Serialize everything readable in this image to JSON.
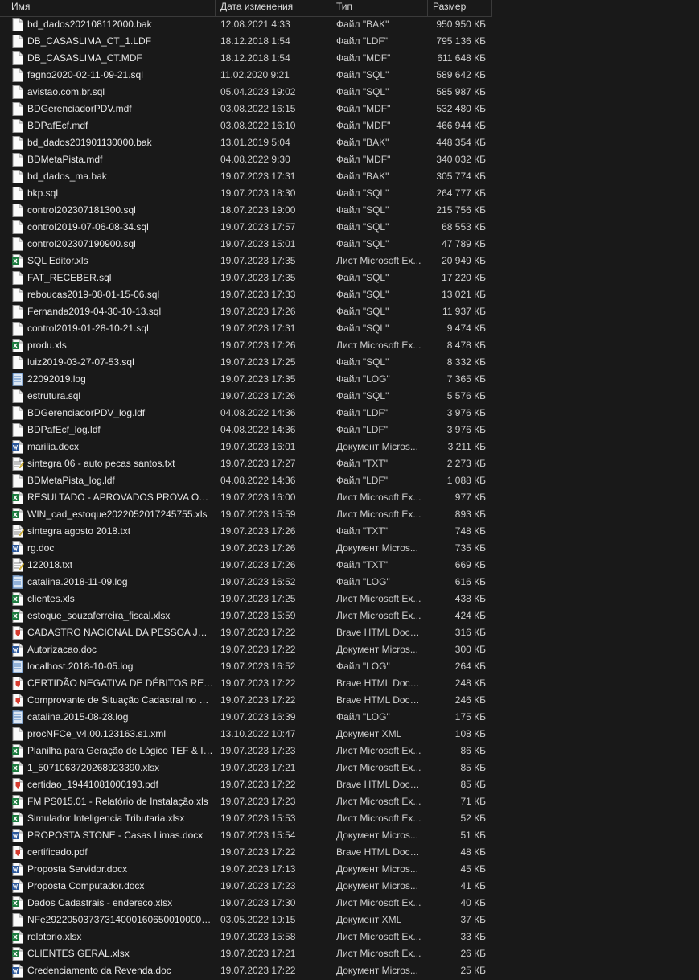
{
  "columns": {
    "name": "Имя",
    "date": "Дата изменения",
    "type": "Тип",
    "size": "Размер"
  },
  "icon_colors": {
    "file": "#ffffff",
    "excel": "#1d7a3f",
    "word": "#2b579a",
    "pdf": "#d63b2f",
    "log": "#4a7fbf",
    "txt": "#e8c84a"
  },
  "files": [
    {
      "name": "bd_dados202108112000.bak",
      "date": "12.08.2021 4:33",
      "type": "Файл \"BAK\"",
      "size": "950 950 КБ",
      "icon": "file"
    },
    {
      "name": "DB_CASASLIMA_CT_1.LDF",
      "date": "18.12.2018 1:54",
      "type": "Файл \"LDF\"",
      "size": "795 136 КБ",
      "icon": "file"
    },
    {
      "name": "DB_CASASLIMA_CT.MDF",
      "date": "18.12.2018 1:54",
      "type": "Файл \"MDF\"",
      "size": "611 648 КБ",
      "icon": "file"
    },
    {
      "name": "fagno2020-02-11-09-21.sql",
      "date": "11.02.2020 9:21",
      "type": "Файл \"SQL\"",
      "size": "589 642 КБ",
      "icon": "file"
    },
    {
      "name": "avistao.com.br.sql",
      "date": "05.04.2023 19:02",
      "type": "Файл \"SQL\"",
      "size": "585 987 КБ",
      "icon": "file"
    },
    {
      "name": "BDGerenciadorPDV.mdf",
      "date": "03.08.2022 16:15",
      "type": "Файл \"MDF\"",
      "size": "532 480 КБ",
      "icon": "file"
    },
    {
      "name": "BDPafEcf.mdf",
      "date": "03.08.2022 16:10",
      "type": "Файл \"MDF\"",
      "size": "466 944 КБ",
      "icon": "file"
    },
    {
      "name": "bd_dados201901130000.bak",
      "date": "13.01.2019 5:04",
      "type": "Файл \"BAK\"",
      "size": "448 354 КБ",
      "icon": "file"
    },
    {
      "name": "BDMetaPista.mdf",
      "date": "04.08.2022 9:30",
      "type": "Файл \"MDF\"",
      "size": "340 032 КБ",
      "icon": "file"
    },
    {
      "name": "bd_dados_ma.bak",
      "date": "19.07.2023 17:31",
      "type": "Файл \"BAK\"",
      "size": "305 774 КБ",
      "icon": "file"
    },
    {
      "name": "bkp.sql",
      "date": "19.07.2023 18:30",
      "type": "Файл \"SQL\"",
      "size": "264 777 КБ",
      "icon": "file"
    },
    {
      "name": "control202307181300.sql",
      "date": "18.07.2023 19:00",
      "type": "Файл \"SQL\"",
      "size": "215 756 КБ",
      "icon": "file"
    },
    {
      "name": "control2019-07-06-08-34.sql",
      "date": "19.07.2023 17:57",
      "type": "Файл \"SQL\"",
      "size": "68 553 КБ",
      "icon": "file"
    },
    {
      "name": "control202307190900.sql",
      "date": "19.07.2023 15:01",
      "type": "Файл \"SQL\"",
      "size": "47 789 КБ",
      "icon": "file"
    },
    {
      "name": "SQL Editor.xls",
      "date": "19.07.2023 17:35",
      "type": "Лист Microsoft Ex...",
      "size": "20 949 КБ",
      "icon": "excel"
    },
    {
      "name": "FAT_RECEBER.sql",
      "date": "19.07.2023 17:35",
      "type": "Файл \"SQL\"",
      "size": "17 220 КБ",
      "icon": "file"
    },
    {
      "name": "reboucas2019-08-01-15-06.sql",
      "date": "19.07.2023 17:33",
      "type": "Файл \"SQL\"",
      "size": "13 021 КБ",
      "icon": "file"
    },
    {
      "name": "Fernanda2019-04-30-10-13.sql",
      "date": "19.07.2023 17:26",
      "type": "Файл \"SQL\"",
      "size": "11 937 КБ",
      "icon": "file"
    },
    {
      "name": "control2019-01-28-10-21.sql",
      "date": "19.07.2023 17:31",
      "type": "Файл \"SQL\"",
      "size": "9 474 КБ",
      "icon": "file"
    },
    {
      "name": "produ.xls",
      "date": "19.07.2023 17:26",
      "type": "Лист Microsoft Ex...",
      "size": "8 478 КБ",
      "icon": "excel"
    },
    {
      "name": "luiz2019-03-27-07-53.sql",
      "date": "19.07.2023 17:25",
      "type": "Файл \"SQL\"",
      "size": "8 332 КБ",
      "icon": "file"
    },
    {
      "name": "22092019.log",
      "date": "19.07.2023 17:35",
      "type": "Файл \"LOG\"",
      "size": "7 365 КБ",
      "icon": "log"
    },
    {
      "name": "estrutura.sql",
      "date": "19.07.2023 17:26",
      "type": "Файл \"SQL\"",
      "size": "5 576 КБ",
      "icon": "file"
    },
    {
      "name": "BDGerenciadorPDV_log.ldf",
      "date": "04.08.2022 14:36",
      "type": "Файл \"LDF\"",
      "size": "3 976 КБ",
      "icon": "file"
    },
    {
      "name": "BDPafEcf_log.ldf",
      "date": "04.08.2022 14:36",
      "type": "Файл \"LDF\"",
      "size": "3 976 КБ",
      "icon": "file"
    },
    {
      "name": "marilia.docx",
      "date": "19.07.2023 16:01",
      "type": "Документ Micros...",
      "size": "3 211 КБ",
      "icon": "word"
    },
    {
      "name": "sintegra 06 - auto pecas santos.txt",
      "date": "19.07.2023 17:27",
      "type": "Файл \"TXT\"",
      "size": "2 273 КБ",
      "icon": "txt"
    },
    {
      "name": "BDMetaPista_log.ldf",
      "date": "04.08.2022 14:36",
      "type": "Файл \"LDF\"",
      "size": "1 088 КБ",
      "icon": "file"
    },
    {
      "name": "RESULTADO - APROVADOS PROVA OBJET...",
      "date": "19.07.2023 16:00",
      "type": "Лист Microsoft Ex...",
      "size": "977 КБ",
      "icon": "excel"
    },
    {
      "name": "WIN_cad_estoque2022052017245755.xls",
      "date": "19.07.2023 15:59",
      "type": "Лист Microsoft Ex...",
      "size": "893 КБ",
      "icon": "excel"
    },
    {
      "name": "sintegra agosto 2018.txt",
      "date": "19.07.2023 17:26",
      "type": "Файл \"TXT\"",
      "size": "748 КБ",
      "icon": "txt"
    },
    {
      "name": "rg.doc",
      "date": "19.07.2023 17:26",
      "type": "Документ Micros...",
      "size": "735 КБ",
      "icon": "word"
    },
    {
      "name": "122018.txt",
      "date": "19.07.2023 17:26",
      "type": "Файл \"TXT\"",
      "size": "669 КБ",
      "icon": "txt"
    },
    {
      "name": "catalina.2018-11-09.log",
      "date": "19.07.2023 16:52",
      "type": "Файл \"LOG\"",
      "size": "616 КБ",
      "icon": "log"
    },
    {
      "name": "clientes.xls",
      "date": "19.07.2023 17:25",
      "type": "Лист Microsoft Ex...",
      "size": "438 КБ",
      "icon": "excel"
    },
    {
      "name": "estoque_souzaferreira_fiscal.xlsx",
      "date": "19.07.2023 15:59",
      "type": "Лист Microsoft Ex...",
      "size": "424 КБ",
      "icon": "excel"
    },
    {
      "name": "CADASTRO NACIONAL DA PESSOA JURÍ...",
      "date": "19.07.2023 17:22",
      "type": "Brave HTML Docu...",
      "size": "316 КБ",
      "icon": "pdf"
    },
    {
      "name": "Autorizacao.doc",
      "date": "19.07.2023 17:22",
      "type": "Документ Micros...",
      "size": "300 КБ",
      "icon": "word"
    },
    {
      "name": "localhost.2018-10-05.log",
      "date": "19.07.2023 16:52",
      "type": "Файл \"LOG\"",
      "size": "264 КБ",
      "icon": "log"
    },
    {
      "name": "CERTIDÃO NEGATIVA DE DÉBITOS RELATI...",
      "date": "19.07.2023 17:22",
      "type": "Brave HTML Docu...",
      "size": "248 КБ",
      "icon": "pdf"
    },
    {
      "name": "Comprovante de Situação Cadastral no C...",
      "date": "19.07.2023 17:22",
      "type": "Brave HTML Docu...",
      "size": "246 КБ",
      "icon": "pdf"
    },
    {
      "name": "catalina.2015-08-28.log",
      "date": "19.07.2023 16:39",
      "type": "Файл \"LOG\"",
      "size": "175 КБ",
      "icon": "log"
    },
    {
      "name": "procNFCe_v4.00.123163.s1.xml",
      "date": "13.10.2022 10:47",
      "type": "Документ XML",
      "size": "108 КБ",
      "icon": "file"
    },
    {
      "name": "Planilha para Geração de Lógico TEF & In...",
      "date": "19.07.2023 17:23",
      "type": "Лист Microsoft Ex...",
      "size": "86 КБ",
      "icon": "excel"
    },
    {
      "name": "1_5071063720268923390.xlsx",
      "date": "19.07.2023 17:21",
      "type": "Лист Microsoft Ex...",
      "size": "85 КБ",
      "icon": "excel"
    },
    {
      "name": "certidao_19441081000193.pdf",
      "date": "19.07.2023 17:22",
      "type": "Brave HTML Docu...",
      "size": "85 КБ",
      "icon": "pdf"
    },
    {
      "name": "FM PS015.01 - Relatório de Instalação.xls",
      "date": "19.07.2023 17:23",
      "type": "Лист Microsoft Ex...",
      "size": "71 КБ",
      "icon": "excel"
    },
    {
      "name": "Simulador Inteligencia Tributaria.xlsx",
      "date": "19.07.2023 15:53",
      "type": "Лист Microsoft Ex...",
      "size": "52 КБ",
      "icon": "excel"
    },
    {
      "name": "PROPOSTA STONE - Casas Limas.docx",
      "date": "19.07.2023 15:54",
      "type": "Документ Micros...",
      "size": "51 КБ",
      "icon": "word"
    },
    {
      "name": "certificado.pdf",
      "date": "19.07.2023 17:22",
      "type": "Brave HTML Docu...",
      "size": "48 КБ",
      "icon": "pdf"
    },
    {
      "name": "Proposta Servidor.docx",
      "date": "19.07.2023 17:13",
      "type": "Документ Micros...",
      "size": "45 КБ",
      "icon": "word"
    },
    {
      "name": "Proposta Computador.docx",
      "date": "19.07.2023 17:23",
      "type": "Документ Micros...",
      "size": "41 КБ",
      "icon": "word"
    },
    {
      "name": "Dados Cadastrais - endereco.xlsx",
      "date": "19.07.2023 17:30",
      "type": "Лист Microsoft Ex...",
      "size": "40 КБ",
      "icon": "excel"
    },
    {
      "name": "NFe29220503737314000160650010000206...",
      "date": "03.05.2022 19:15",
      "type": "Документ XML",
      "size": "37 КБ",
      "icon": "file"
    },
    {
      "name": "relatorio.xlsx",
      "date": "19.07.2023 15:58",
      "type": "Лист Microsoft Ex...",
      "size": "33 КБ",
      "icon": "excel"
    },
    {
      "name": "CLIENTES GERAL.xlsx",
      "date": "19.07.2023 17:21",
      "type": "Лист Microsoft Ex...",
      "size": "26 КБ",
      "icon": "excel"
    },
    {
      "name": "Credenciamento da Revenda.doc",
      "date": "19.07.2023 17:22",
      "type": "Документ Micros...",
      "size": "25 КБ",
      "icon": "word"
    }
  ]
}
